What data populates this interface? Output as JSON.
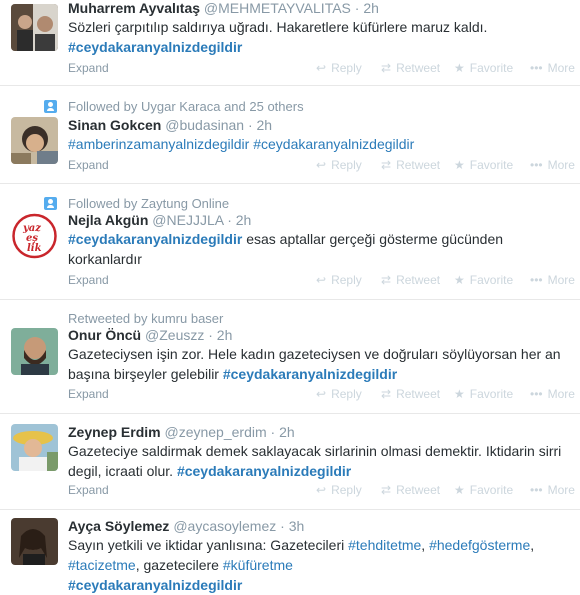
{
  "actions": {
    "expand": "Expand",
    "reply": "Reply",
    "retweet": "Retweet",
    "favorite": "Favorite",
    "more": "More",
    "icons": {
      "reply": "reply-arrow-icon",
      "retweet": "retweet-arrows-icon",
      "favorite": "star-icon",
      "more": "dots-icon"
    }
  },
  "colors": {
    "hashtag": "#2b7bb9",
    "muted": "#8899a6",
    "action": "#ccd6dd",
    "text": "#292f33"
  },
  "tweets": [
    {
      "fullname": "Muharrem Ayvalıtaş",
      "username": "@MEHMETAYVALITAS",
      "time": "· 2h",
      "text_1": "Sözleri çarpıtılıp saldırıya uğradı. Hakaretlere küfürlere maruz kaldı.",
      "tag_1": "#ceydakaranyalnizdegildir"
    },
    {
      "context": "Followed by Uygar Karaca and 25 others",
      "fullname": "Sinan Gokcen",
      "username": "@budasinan",
      "time": "· 2h",
      "tag_1": "#amberinzamanyalnizdegildir",
      "tag_2": "#ceydakaranyalnizdegildir"
    },
    {
      "context": "Followed by Zaytung Online",
      "fullname": "Nejla Akgün",
      "username": "@NEJJJLA",
      "time": "· 2h",
      "tag_1": "#ceydakaranyalnizdegildir",
      "text_1": " esas aptallar gerçeği gösterme gücünden",
      "text_2": "korkanlardır",
      "avatar_text": "yaz es lik"
    },
    {
      "context": "Retweeted by kumru baser",
      "fullname": "Onur Öncü",
      "username": "@Zeuszz",
      "time": "· 2h",
      "text_1": "Gazeteciysen işin zor. Hele kadın gazeteciysen ve doğruları söylüyorsan her an",
      "text_2": "başına birşeyler gelebilir ",
      "tag_1": "#ceydakaranyalnizdegildir"
    },
    {
      "fullname": "Zeynep Erdim",
      "username": "@zeynep_erdim",
      "time": "· 2h",
      "text_1": "Gazeteciye saldirmak demek saklayacak sirlarinin olmasi demektir. Iktidarin sirri",
      "text_2": "degil, icraati olur. ",
      "tag_1": "#ceydakaranyalnizdegildir"
    },
    {
      "fullname": "Ayça Söylemez",
      "username": "@aycasoylemez",
      "time": "· 3h",
      "text_1": "Sayın yetkili ve iktidar yanlısına: Gazetecileri ",
      "tag_1": "#tehditetme",
      "sep_1": ", ",
      "tag_2": "#hedefgösterme",
      "sep_2": ",",
      "tag_3": "#tacizetme",
      "text_2": ", gazetecilere ",
      "tag_4": "#küfüretme",
      "tag_5": "#ceydakaranyalnizdegildir"
    }
  ]
}
